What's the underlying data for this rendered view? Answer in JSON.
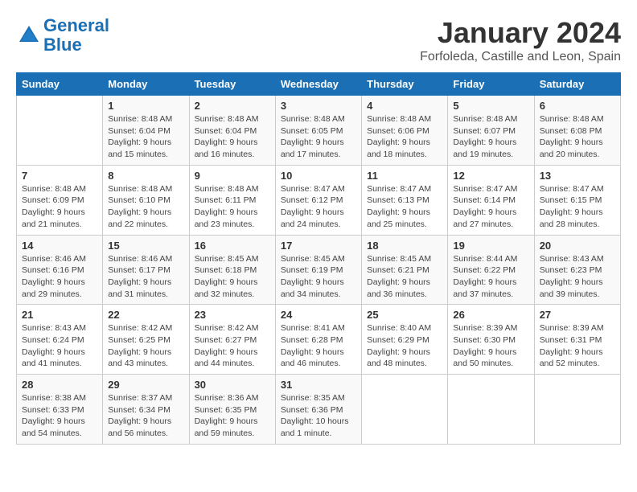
{
  "header": {
    "logo_line1": "General",
    "logo_line2": "Blue",
    "month": "January 2024",
    "location": "Forfoleda, Castille and Leon, Spain"
  },
  "weekdays": [
    "Sunday",
    "Monday",
    "Tuesday",
    "Wednesday",
    "Thursday",
    "Friday",
    "Saturday"
  ],
  "weeks": [
    [
      {
        "day": "",
        "sunrise": "",
        "sunset": "",
        "daylight": ""
      },
      {
        "day": "1",
        "sunrise": "Sunrise: 8:48 AM",
        "sunset": "Sunset: 6:04 PM",
        "daylight": "Daylight: 9 hours and 15 minutes."
      },
      {
        "day": "2",
        "sunrise": "Sunrise: 8:48 AM",
        "sunset": "Sunset: 6:04 PM",
        "daylight": "Daylight: 9 hours and 16 minutes."
      },
      {
        "day": "3",
        "sunrise": "Sunrise: 8:48 AM",
        "sunset": "Sunset: 6:05 PM",
        "daylight": "Daylight: 9 hours and 17 minutes."
      },
      {
        "day": "4",
        "sunrise": "Sunrise: 8:48 AM",
        "sunset": "Sunset: 6:06 PM",
        "daylight": "Daylight: 9 hours and 18 minutes."
      },
      {
        "day": "5",
        "sunrise": "Sunrise: 8:48 AM",
        "sunset": "Sunset: 6:07 PM",
        "daylight": "Daylight: 9 hours and 19 minutes."
      },
      {
        "day": "6",
        "sunrise": "Sunrise: 8:48 AM",
        "sunset": "Sunset: 6:08 PM",
        "daylight": "Daylight: 9 hours and 20 minutes."
      }
    ],
    [
      {
        "day": "7",
        "sunrise": "Sunrise: 8:48 AM",
        "sunset": "Sunset: 6:09 PM",
        "daylight": "Daylight: 9 hours and 21 minutes."
      },
      {
        "day": "8",
        "sunrise": "Sunrise: 8:48 AM",
        "sunset": "Sunset: 6:10 PM",
        "daylight": "Daylight: 9 hours and 22 minutes."
      },
      {
        "day": "9",
        "sunrise": "Sunrise: 8:48 AM",
        "sunset": "Sunset: 6:11 PM",
        "daylight": "Daylight: 9 hours and 23 minutes."
      },
      {
        "day": "10",
        "sunrise": "Sunrise: 8:47 AM",
        "sunset": "Sunset: 6:12 PM",
        "daylight": "Daylight: 9 hours and 24 minutes."
      },
      {
        "day": "11",
        "sunrise": "Sunrise: 8:47 AM",
        "sunset": "Sunset: 6:13 PM",
        "daylight": "Daylight: 9 hours and 25 minutes."
      },
      {
        "day": "12",
        "sunrise": "Sunrise: 8:47 AM",
        "sunset": "Sunset: 6:14 PM",
        "daylight": "Daylight: 9 hours and 27 minutes."
      },
      {
        "day": "13",
        "sunrise": "Sunrise: 8:47 AM",
        "sunset": "Sunset: 6:15 PM",
        "daylight": "Daylight: 9 hours and 28 minutes."
      }
    ],
    [
      {
        "day": "14",
        "sunrise": "Sunrise: 8:46 AM",
        "sunset": "Sunset: 6:16 PM",
        "daylight": "Daylight: 9 hours and 29 minutes."
      },
      {
        "day": "15",
        "sunrise": "Sunrise: 8:46 AM",
        "sunset": "Sunset: 6:17 PM",
        "daylight": "Daylight: 9 hours and 31 minutes."
      },
      {
        "day": "16",
        "sunrise": "Sunrise: 8:45 AM",
        "sunset": "Sunset: 6:18 PM",
        "daylight": "Daylight: 9 hours and 32 minutes."
      },
      {
        "day": "17",
        "sunrise": "Sunrise: 8:45 AM",
        "sunset": "Sunset: 6:19 PM",
        "daylight": "Daylight: 9 hours and 34 minutes."
      },
      {
        "day": "18",
        "sunrise": "Sunrise: 8:45 AM",
        "sunset": "Sunset: 6:21 PM",
        "daylight": "Daylight: 9 hours and 36 minutes."
      },
      {
        "day": "19",
        "sunrise": "Sunrise: 8:44 AM",
        "sunset": "Sunset: 6:22 PM",
        "daylight": "Daylight: 9 hours and 37 minutes."
      },
      {
        "day": "20",
        "sunrise": "Sunrise: 8:43 AM",
        "sunset": "Sunset: 6:23 PM",
        "daylight": "Daylight: 9 hours and 39 minutes."
      }
    ],
    [
      {
        "day": "21",
        "sunrise": "Sunrise: 8:43 AM",
        "sunset": "Sunset: 6:24 PM",
        "daylight": "Daylight: 9 hours and 41 minutes."
      },
      {
        "day": "22",
        "sunrise": "Sunrise: 8:42 AM",
        "sunset": "Sunset: 6:25 PM",
        "daylight": "Daylight: 9 hours and 43 minutes."
      },
      {
        "day": "23",
        "sunrise": "Sunrise: 8:42 AM",
        "sunset": "Sunset: 6:27 PM",
        "daylight": "Daylight: 9 hours and 44 minutes."
      },
      {
        "day": "24",
        "sunrise": "Sunrise: 8:41 AM",
        "sunset": "Sunset: 6:28 PM",
        "daylight": "Daylight: 9 hours and 46 minutes."
      },
      {
        "day": "25",
        "sunrise": "Sunrise: 8:40 AM",
        "sunset": "Sunset: 6:29 PM",
        "daylight": "Daylight: 9 hours and 48 minutes."
      },
      {
        "day": "26",
        "sunrise": "Sunrise: 8:39 AM",
        "sunset": "Sunset: 6:30 PM",
        "daylight": "Daylight: 9 hours and 50 minutes."
      },
      {
        "day": "27",
        "sunrise": "Sunrise: 8:39 AM",
        "sunset": "Sunset: 6:31 PM",
        "daylight": "Daylight: 9 hours and 52 minutes."
      }
    ],
    [
      {
        "day": "28",
        "sunrise": "Sunrise: 8:38 AM",
        "sunset": "Sunset: 6:33 PM",
        "daylight": "Daylight: 9 hours and 54 minutes."
      },
      {
        "day": "29",
        "sunrise": "Sunrise: 8:37 AM",
        "sunset": "Sunset: 6:34 PM",
        "daylight": "Daylight: 9 hours and 56 minutes."
      },
      {
        "day": "30",
        "sunrise": "Sunrise: 8:36 AM",
        "sunset": "Sunset: 6:35 PM",
        "daylight": "Daylight: 9 hours and 59 minutes."
      },
      {
        "day": "31",
        "sunrise": "Sunrise: 8:35 AM",
        "sunset": "Sunset: 6:36 PM",
        "daylight": "Daylight: 10 hours and 1 minute."
      },
      {
        "day": "",
        "sunrise": "",
        "sunset": "",
        "daylight": ""
      },
      {
        "day": "",
        "sunrise": "",
        "sunset": "",
        "daylight": ""
      },
      {
        "day": "",
        "sunrise": "",
        "sunset": "",
        "daylight": ""
      }
    ]
  ]
}
